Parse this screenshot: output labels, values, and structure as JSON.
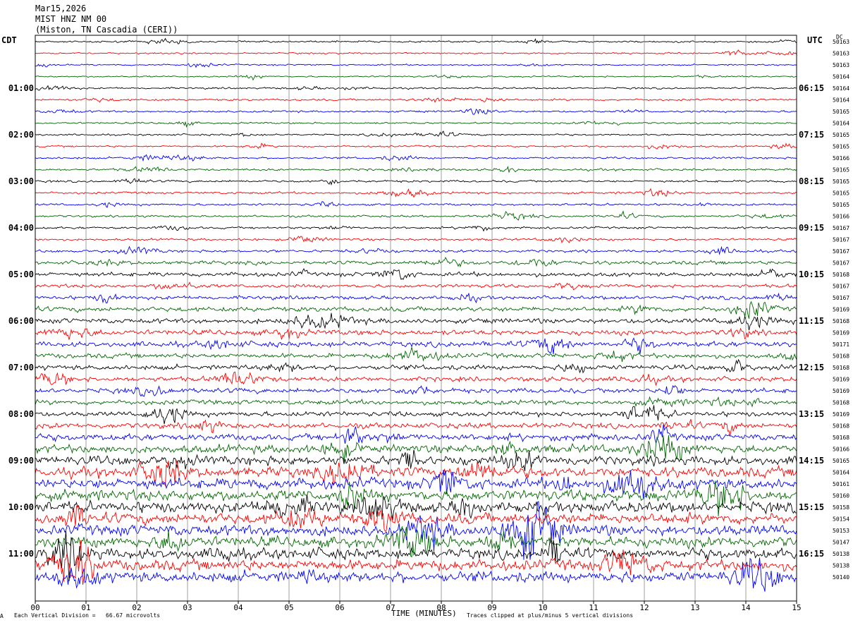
{
  "header": {
    "date": "Mar15,2026",
    "channel": "MIST HNZ NM 00",
    "station": "(Miston, TN Cascadia (CERI))"
  },
  "left_zone": "CDT",
  "right_zone": "UTC",
  "dc_header": "DC",
  "footer": {
    "scale_note": "Each Vertical Division =   66.67 microvolts",
    "x_title": "TIME (MINUTES)",
    "clip_note": "Traces clipped at plus/minus 5 vertical divisions",
    "corner_mark": "A"
  },
  "colors": {
    "black": "#000000",
    "red": "#ff0000",
    "blue": "#0000ff",
    "green": "#006600",
    "grid": "#888888"
  },
  "chart_data": {
    "type": "line",
    "title": "MIST HNZ NM 00",
    "xlabel": "TIME (MINUTES)",
    "ylabel": "",
    "xlim": [
      0,
      15
    ],
    "x_ticks": [
      "00",
      "01",
      "02",
      "03",
      "04",
      "05",
      "06",
      "07",
      "08",
      "09",
      "10",
      "11",
      "12",
      "13",
      "14",
      "15"
    ],
    "left_hour_labels": [
      "01:00",
      "02:00",
      "03:00",
      "04:00",
      "05:00",
      "06:00",
      "07:00",
      "08:00",
      "09:00",
      "10:00",
      "11:00"
    ],
    "right_hour_labels": [
      "06:15",
      "07:15",
      "08:15",
      "09:15",
      "10:15",
      "11:15",
      "12:15",
      "13:15",
      "14:15",
      "15:15",
      "16:15"
    ],
    "trace_color_cycle": [
      "black",
      "red",
      "blue",
      "green"
    ],
    "trace_dc_offsets": [
      50163,
      50163,
      50163,
      50164,
      50164,
      50164,
      50165,
      50164,
      50165,
      50165,
      50166,
      50165,
      50165,
      50165,
      50165,
      50166,
      50167,
      50167,
      50167,
      50167,
      50168,
      50167,
      50167,
      50169,
      50168,
      50169,
      50171,
      50168,
      50168,
      50169,
      50169,
      50168,
      50169,
      50168,
      50168,
      50166,
      50165,
      50164,
      50161,
      50160,
      50158,
      50154,
      50153,
      50147,
      50138,
      50138,
      50140
    ],
    "trace_relative_amplitude": [
      0.8,
      0.7,
      0.7,
      0.7,
      0.8,
      0.9,
      0.9,
      0.8,
      0.8,
      0.8,
      0.9,
      1.0,
      1.0,
      1.0,
      1.0,
      1.0,
      1.0,
      1.0,
      1.2,
      1.7,
      1.9,
      1.6,
      1.7,
      2.2,
      2.3,
      2.4,
      2.5,
      2.2,
      2.3,
      2.2,
      2.2,
      2.2,
      2.2,
      2.5,
      3.0,
      3.8,
      4.2,
      4.6,
      5.0,
      5.0,
      5.0,
      5.0,
      5.0,
      5.0,
      5.0,
      5.0,
      5.0
    ]
  }
}
